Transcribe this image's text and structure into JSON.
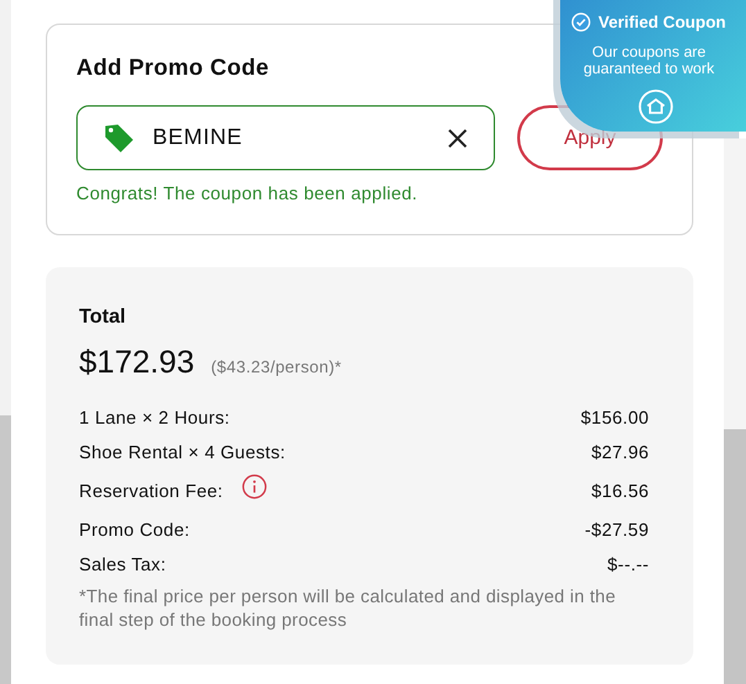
{
  "badge": {
    "title": "Verified Coupon",
    "text": "Our coupons are guaranteed to work"
  },
  "promo": {
    "title": "Add Promo Code",
    "value": "BEMINE",
    "button": "Apply",
    "message": "Congrats! The coupon has been applied.",
    "applied": true
  },
  "summary": {
    "label": "Total",
    "amount": "$172.93",
    "per_person": "($43.23/person)*",
    "lines": [
      {
        "label": "1 Lane × 2 Hours:",
        "value": "$156.00",
        "info": false
      },
      {
        "label": "Shoe Rental × 4 Guests:",
        "value": "$27.96",
        "info": false
      },
      {
        "label": "Reservation Fee:",
        "value": "$16.56",
        "info": true
      },
      {
        "label": "Promo Code:",
        "value": "-$27.59",
        "info": false
      },
      {
        "label": "Sales Tax:",
        "value": "$--.--",
        "info": false
      }
    ],
    "note": "*The final price per person will be calculated and displayed in the final step of the booking process"
  }
}
